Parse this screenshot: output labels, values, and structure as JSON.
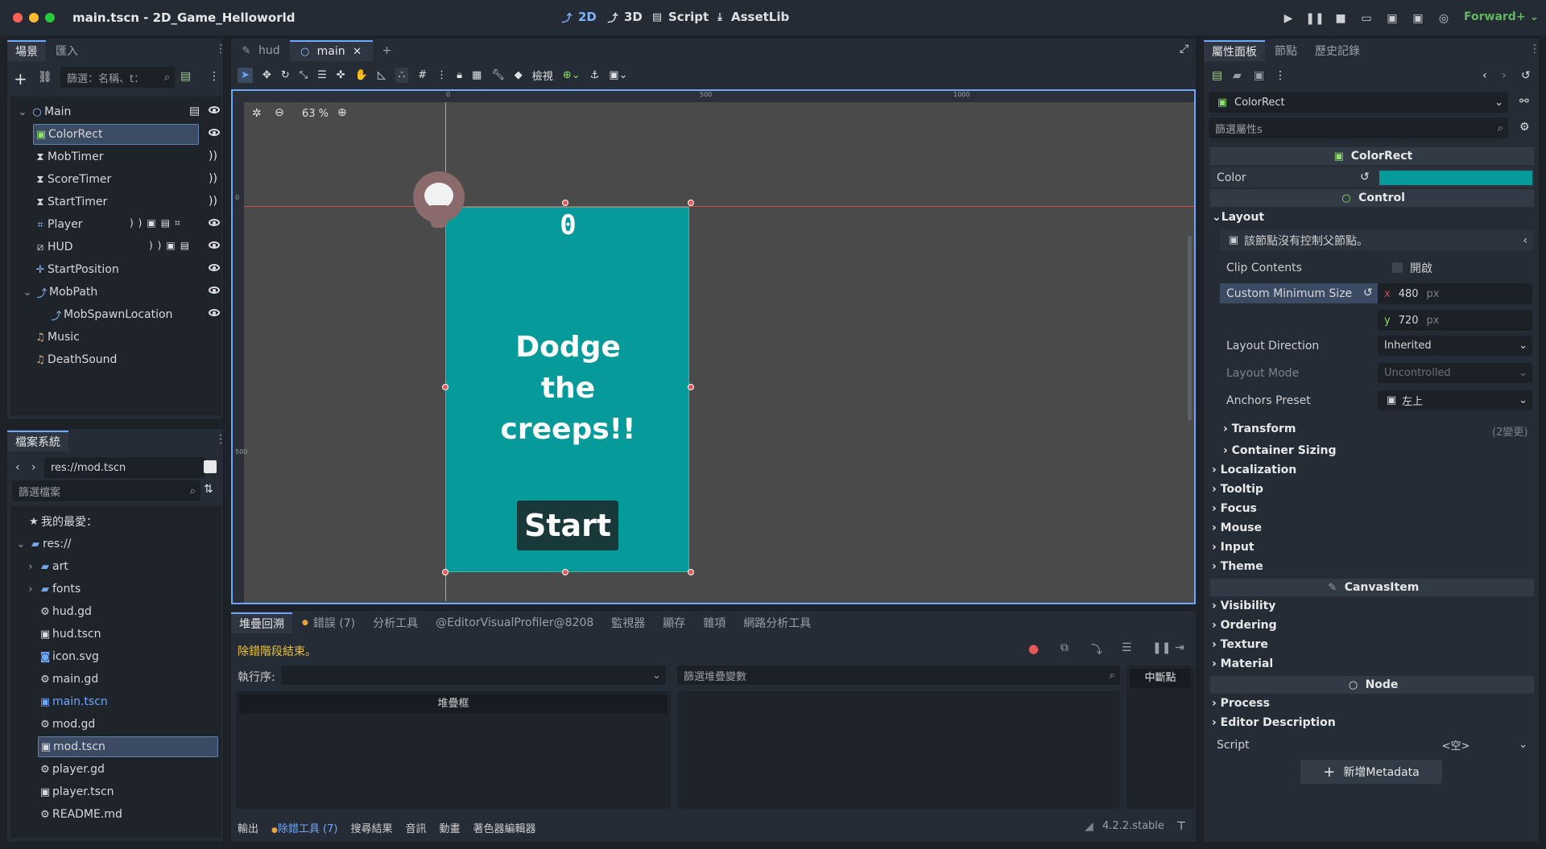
{
  "window": {
    "title": "main.tscn - 2D_Game_Helloworld"
  },
  "modes": {
    "m2d": "2D",
    "m3d": "3D",
    "script": "Script",
    "assetlib": "AssetLib"
  },
  "renderer": "Forward+",
  "scene_dock": {
    "tab_scene": "場景",
    "tab_import": "匯入",
    "filter_placeholder": "篩選：名稱、t：",
    "nodes": [
      "Main",
      "ColorRect",
      "MobTimer",
      "ScoreTimer",
      "StartTimer",
      "Player",
      "HUD",
      "StartPosition",
      "MobPath",
      "MobSpawnLocation",
      "Music",
      "DeathSound"
    ]
  },
  "fs_dock": {
    "title": "檔案系統",
    "path": "res://mod.tscn",
    "filter_placeholder": "篩選檔案",
    "favorites": "我的最愛：",
    "items": [
      "res://",
      "art",
      "fonts",
      "hud.gd",
      "hud.tscn",
      "icon.svg",
      "main.gd",
      "main.tscn",
      "mod.gd",
      "mod.tscn",
      "player.gd",
      "player.tscn",
      "README.md"
    ]
  },
  "editor_tabs": {
    "hud": "hud",
    "main": "main"
  },
  "toolbar": {
    "view": "檢視"
  },
  "viewport": {
    "zoom": "63 %",
    "ruler_0": "0",
    "ruler_500": "500",
    "ruler_1000": "1000",
    "vruler_0": "0",
    "vruler_500": "500",
    "score": "0",
    "message": [
      "Dodge",
      "the",
      "creeps!!"
    ],
    "start": "Start",
    "bg_color": "#079a9b"
  },
  "bottom": {
    "tabs": [
      "堆疊回溯",
      "錯誤 (7)",
      "分析工具",
      "@EditorVisualProfiler@8208",
      "監視器",
      "顯存",
      "雜項",
      "網路分析工具"
    ],
    "status": "除錯階段結束。",
    "thread_label": "執行序:",
    "stack_frames": "堆疊框",
    "filter_vars": "篩選堆疊變數",
    "breakpoints": "中斷點",
    "bar": [
      "輸出",
      "除錯工具 (7)",
      "搜尋結果",
      "音訊",
      "動畫",
      "著色器編輯器"
    ],
    "version": "4.2.2.stable"
  },
  "inspector": {
    "tabs": [
      "屬性面板",
      "節點",
      "歷史記錄"
    ],
    "node_name": "ColorRect",
    "filter_placeholder": "篩選屬性s",
    "class_colorrect": "ColorRect",
    "color_label": "Color",
    "color_value": "#079a9b",
    "class_control": "Control",
    "layout": "Layout",
    "warning": "該節點沒有控制父節點。",
    "clip_contents": "Clip Contents",
    "clip_value": "開啟",
    "min_size": "Custom Minimum Size",
    "x_label": "x",
    "x_value": "480",
    "y_label": "y",
    "y_value": "720",
    "px": "px",
    "layout_direction": "Layout Direction",
    "layout_direction_value": "Inherited",
    "layout_mode": "Layout Mode",
    "layout_mode_value": "Uncontrolled",
    "anchors_preset": "Anchors Preset",
    "anchors_value": "左上",
    "transform": "Transform",
    "transform_changes": "(2變更)",
    "container_sizing": "Container Sizing",
    "groups1": [
      "Localization",
      "Tooltip",
      "Focus",
      "Mouse",
      "Input",
      "Theme"
    ],
    "class_canvasitem": "CanvasItem",
    "groups2": [
      "Visibility",
      "Ordering",
      "Texture",
      "Material"
    ],
    "class_node": "Node",
    "groups3": [
      "Process",
      "Editor Description"
    ],
    "script_label": "Script",
    "script_value": "<空>",
    "add_metadata": "新增Metadata"
  }
}
